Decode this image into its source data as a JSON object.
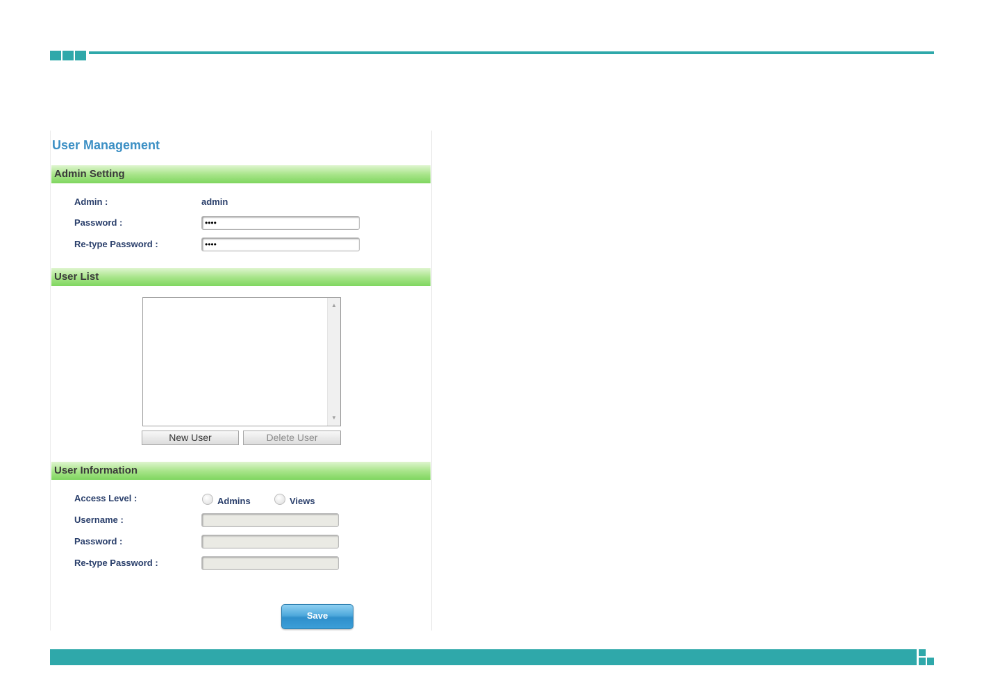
{
  "page": {
    "title": "User Management"
  },
  "admin_setting": {
    "header": "Admin Setting",
    "admin_label": "Admin :",
    "admin_value": "admin",
    "password_label": "Password :",
    "password_value": "••••",
    "retype_label": "Re-type Password :",
    "retype_value": "••••"
  },
  "user_list": {
    "header": "User List",
    "items": [],
    "new_user_label": "New User",
    "delete_user_label": "Delete User"
  },
  "user_information": {
    "header": "User Information",
    "access_level_label": "Access Level :",
    "access_options": [
      "Admins",
      "Views"
    ],
    "username_label": "Username :",
    "password_label": "Password :",
    "retype_label": "Re-type Password :"
  },
  "save_label": "Save",
  "colors": {
    "accent": "#2fa8aa",
    "title": "#3b8fc4",
    "section": "#8fdc6c",
    "save": "#3c9fd8"
  }
}
